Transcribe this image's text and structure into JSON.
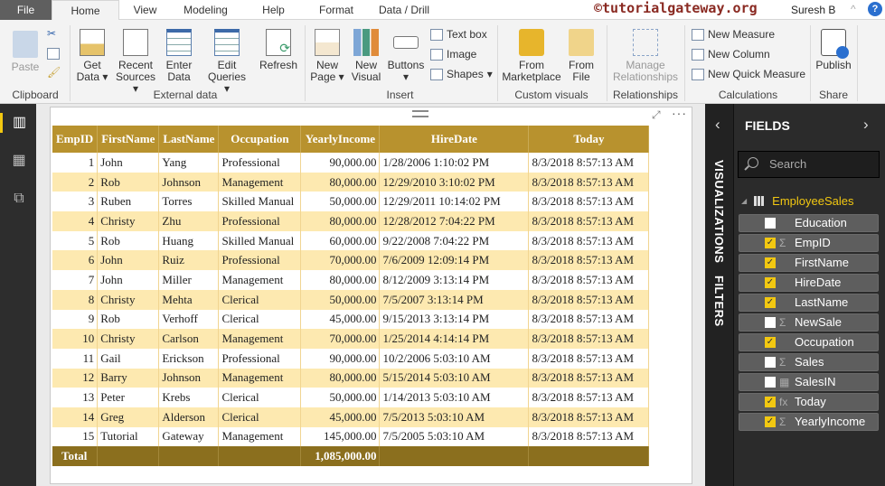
{
  "tabs": [
    "File",
    "Home",
    "View",
    "Modeling",
    "Help",
    "Format",
    "Data / Drill"
  ],
  "watermark": "©tutorialgateway.org",
  "user": "Suresh B",
  "ribbon": {
    "clipboard": {
      "paste": "Paste",
      "group": "Clipboard"
    },
    "external": {
      "get_data": "Get Data",
      "recent": "Recent Sources",
      "enter": "Enter Data",
      "edit": "Edit Queries",
      "refresh": "Refresh",
      "group": "External data"
    },
    "insert": {
      "new_page": "New Page",
      "new_visual": "New Visual",
      "buttons": "Buttons",
      "text_box": "Text box",
      "image": "Image",
      "shapes": "Shapes",
      "group": "Insert"
    },
    "custom": {
      "marketplace": "From Marketplace",
      "file": "From File",
      "group": "Custom visuals"
    },
    "relationships": {
      "manage": "Manage Relationships",
      "group": "Relationships"
    },
    "calc": {
      "measure": "New Measure",
      "column": "New Column",
      "quick": "New Quick Measure",
      "group": "Calculations"
    },
    "share": {
      "publish": "Publish",
      "group": "Share"
    }
  },
  "table": {
    "columns": [
      "EmpID",
      "FirstName",
      "LastName",
      "Occupation",
      "YearlyIncome",
      "HireDate",
      "Today"
    ],
    "rows": [
      [
        "1",
        "John",
        "Yang",
        "Professional",
        "90,000.00",
        "1/28/2006 1:10:02 PM",
        "8/3/2018 8:57:13 AM"
      ],
      [
        "2",
        "Rob",
        "Johnson",
        "Management",
        "80,000.00",
        "12/29/2010 3:10:02 PM",
        "8/3/2018 8:57:13 AM"
      ],
      [
        "3",
        "Ruben",
        "Torres",
        "Skilled Manual",
        "50,000.00",
        "12/29/2011 10:14:02 PM",
        "8/3/2018 8:57:13 AM"
      ],
      [
        "4",
        "Christy",
        "Zhu",
        "Professional",
        "80,000.00",
        "12/28/2012 7:04:22 PM",
        "8/3/2018 8:57:13 AM"
      ],
      [
        "5",
        "Rob",
        "Huang",
        "Skilled Manual",
        "60,000.00",
        "9/22/2008 7:04:22 PM",
        "8/3/2018 8:57:13 AM"
      ],
      [
        "6",
        "John",
        "Ruiz",
        "Professional",
        "70,000.00",
        "7/6/2009 12:09:14 PM",
        "8/3/2018 8:57:13 AM"
      ],
      [
        "7",
        "John",
        "Miller",
        "Management",
        "80,000.00",
        "8/12/2009 3:13:14 PM",
        "8/3/2018 8:57:13 AM"
      ],
      [
        "8",
        "Christy",
        "Mehta",
        "Clerical",
        "50,000.00",
        "7/5/2007 3:13:14 PM",
        "8/3/2018 8:57:13 AM"
      ],
      [
        "9",
        "Rob",
        "Verhoff",
        "Clerical",
        "45,000.00",
        "9/15/2013 3:13:14 PM",
        "8/3/2018 8:57:13 AM"
      ],
      [
        "10",
        "Christy",
        "Carlson",
        "Management",
        "70,000.00",
        "1/25/2014 4:14:14 PM",
        "8/3/2018 8:57:13 AM"
      ],
      [
        "11",
        "Gail",
        "Erickson",
        "Professional",
        "90,000.00",
        "10/2/2006 5:03:10 AM",
        "8/3/2018 8:57:13 AM"
      ],
      [
        "12",
        "Barry",
        "Johnson",
        "Management",
        "80,000.00",
        "5/15/2014 5:03:10 AM",
        "8/3/2018 8:57:13 AM"
      ],
      [
        "13",
        "Peter",
        "Krebs",
        "Clerical",
        "50,000.00",
        "1/14/2013 5:03:10 AM",
        "8/3/2018 8:57:13 AM"
      ],
      [
        "14",
        "Greg",
        "Alderson",
        "Clerical",
        "45,000.00",
        "7/5/2013 5:03:10 AM",
        "8/3/2018 8:57:13 AM"
      ],
      [
        "15",
        "Tutorial",
        "Gateway",
        "Management",
        "145,000.00",
        "7/5/2005 5:03:10 AM",
        "8/3/2018 8:57:13 AM"
      ]
    ],
    "total_label": "Total",
    "total_income": "1,085,000.00"
  },
  "panes": {
    "visualizations": "VISUALIZATIONS",
    "filters": "FILTERS"
  },
  "fields": {
    "title": "FIELDS",
    "search_placeholder": "Search",
    "table_name": "EmployeeSales",
    "items": [
      {
        "name": "Education",
        "checked": false,
        "type": ""
      },
      {
        "name": "EmpID",
        "checked": true,
        "type": "Σ"
      },
      {
        "name": "FirstName",
        "checked": true,
        "type": ""
      },
      {
        "name": "HireDate",
        "checked": true,
        "type": ""
      },
      {
        "name": "LastName",
        "checked": true,
        "type": ""
      },
      {
        "name": "NewSale",
        "checked": false,
        "type": "Σ"
      },
      {
        "name": "Occupation",
        "checked": true,
        "type": ""
      },
      {
        "name": "Sales",
        "checked": false,
        "type": "Σ"
      },
      {
        "name": "SalesIN",
        "checked": false,
        "type": "▦"
      },
      {
        "name": "Today",
        "checked": true,
        "type": "fx"
      },
      {
        "name": "YearlyIncome",
        "checked": true,
        "type": "Σ"
      }
    ]
  },
  "colors": {
    "header": "#b8922e",
    "alt_row": "#fde9b0",
    "total": "#8b6f1e",
    "accent": "#f2c811"
  }
}
